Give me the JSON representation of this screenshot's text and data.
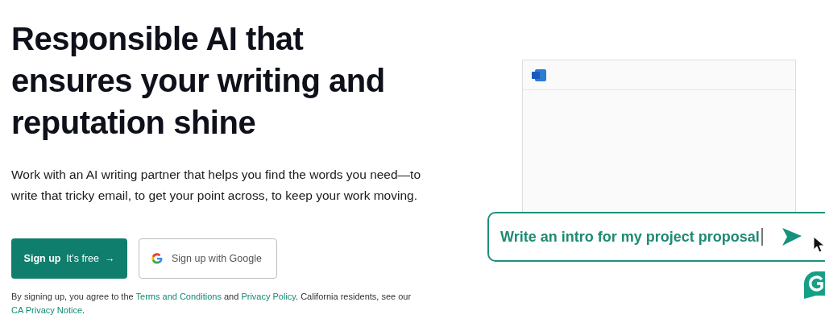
{
  "hero": {
    "heading": "Responsible AI that ensures your writing and reputation shine",
    "description": "Work with an AI writing partner that helps you find the words you need—to write that tricky email, to get your point across, to keep your work moving."
  },
  "buttons": [
    {
      "kind": "primary",
      "label": "Sign up",
      "sublabel": "It's free",
      "arrow": "→"
    },
    {
      "kind": "google",
      "label": "Sign up with Google"
    }
  ],
  "legal": [
    {
      "kind": "text",
      "text": "By signing up, you agree to the "
    },
    {
      "kind": "link",
      "text": "Terms and Conditions"
    },
    {
      "kind": "text",
      "text": " and "
    },
    {
      "kind": "link",
      "text": "Privacy Policy"
    },
    {
      "kind": "text",
      "text": ". California residents, see our "
    },
    {
      "kind": "link",
      "text": "CA Privacy Notice"
    },
    {
      "kind": "text",
      "text": "."
    }
  ],
  "demo": {
    "prompt": "Write an intro for my project proposal"
  }
}
